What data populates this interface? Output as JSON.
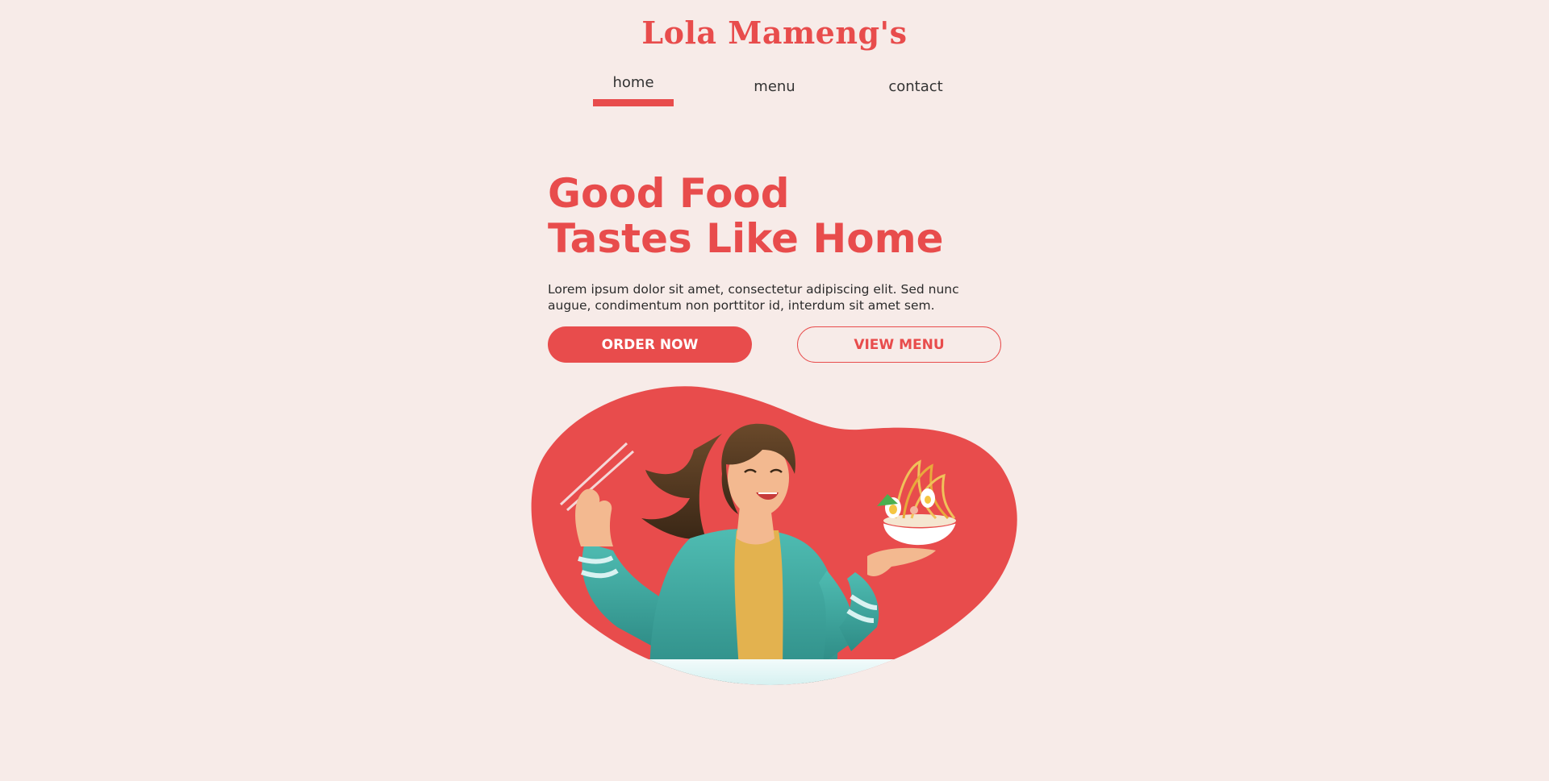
{
  "header": {
    "logo": "Lola Mameng's"
  },
  "nav": {
    "items": [
      {
        "label": "home",
        "active": true
      },
      {
        "label": "menu",
        "active": false
      },
      {
        "label": "contact",
        "active": false
      }
    ]
  },
  "hero": {
    "headline_line1": "Good Food",
    "headline_line2": "Tastes Like Home",
    "description": "Lorem ipsum dolor sit amet, consectetur adipiscing elit. Sed nunc augue, condimentum non porttitor id, interdum sit amet sem.",
    "order_button": "ORDER NOW",
    "menu_button": "VIEW MENU"
  },
  "colors": {
    "background": "#f7ebe8",
    "accent": "#e84c4c",
    "text": "#2b2b2b",
    "jacket": "#3aa8a0",
    "shirt": "#e3b24f"
  }
}
